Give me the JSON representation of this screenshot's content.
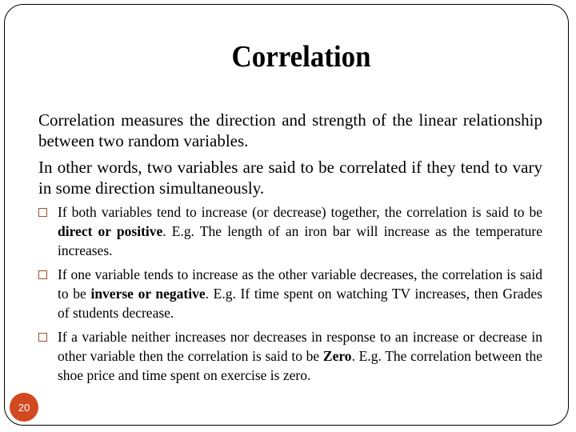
{
  "slide": {
    "title": "Correlation",
    "paragraphs": [
      "Correlation measures the direction  and strength of the linear relationship between two random variables.",
      "In other words, two variables are said to be correlated if they tend to vary in some direction simultaneously."
    ],
    "bullets": [
      {
        "before": "If both variables tend to increase (or decrease) together, the correlation is said to be ",
        "bold": "direct or positive",
        "after": ". E.g. The length of an iron bar will increase as the temperature increases."
      },
      {
        "before": "If one variable tends to increase as the other variable decreases, the correlation is said to be ",
        "bold": "inverse or negative",
        "after": ". E.g. If time spent on watching TV increases, then Grades of students decrease."
      },
      {
        "before": "If a variable neither increases nor decreases in response to an increase or decrease in other variable then the correlation is said to be ",
        "bold": "Zero",
        "after": ". E.g. The correlation between the shoe price and time spent on exercise is zero."
      }
    ],
    "bullet_icon": "hollow-square-icon",
    "page_number": "20",
    "colors": {
      "accent": "#d2491f",
      "bullet_box": "#a0522d",
      "text": "#000000",
      "background": "#ffffff"
    }
  }
}
